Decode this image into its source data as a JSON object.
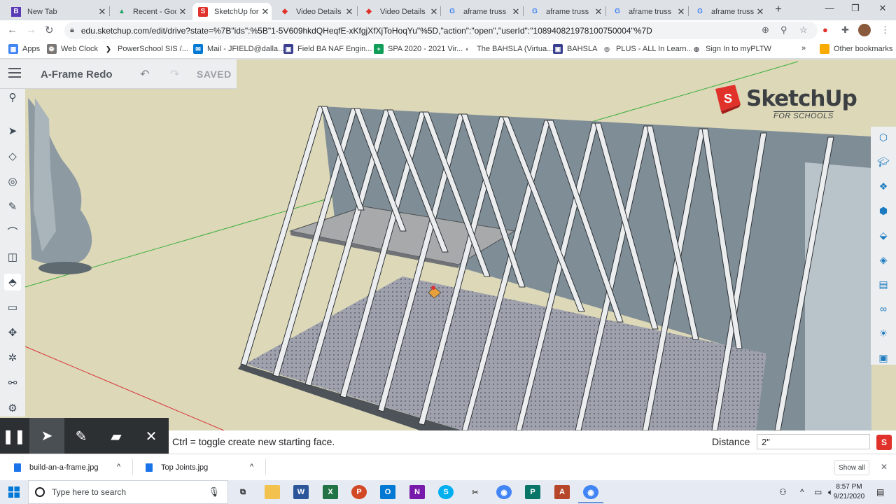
{
  "browser": {
    "tabs": [
      {
        "title": "New Tab",
        "favicon": "B",
        "color": "#5b3bb5"
      },
      {
        "title": "Recent - Goog",
        "favicon": "▲",
        "color": "#1fa463"
      },
      {
        "title": "SketchUp for S",
        "favicon": "S",
        "color": "#e0312b",
        "active": true
      },
      {
        "title": "Video Details",
        "favicon": "◆",
        "color": "#e0312b"
      },
      {
        "title": "Video Details",
        "favicon": "◆",
        "color": "#e0312b"
      },
      {
        "title": "aframe truss",
        "favicon": "G",
        "color": "#4285f4"
      },
      {
        "title": "aframe truss",
        "favicon": "G",
        "color": "#4285f4"
      },
      {
        "title": "aframe truss",
        "favicon": "G",
        "color": "#4285f4"
      },
      {
        "title": "aframe truss",
        "favicon": "G",
        "color": "#4285f4"
      }
    ],
    "url": "edu.sketchup.com/edit/drive?state=%7B\"ids\":%5B\"1-5V609hkdQHeqfE-xKfgjXfXjToHoqYu\"%5D,\"action\":\"open\",\"userId\":\"108940821978100750004\"%7D",
    "bookmarks": [
      {
        "label": "Apps",
        "color": "#4285f4",
        "icon": "▦"
      },
      {
        "label": "Web Clock",
        "color": "#777777",
        "icon": "⌚"
      },
      {
        "label": "PowerSchool SIS /...",
        "color": "#202124",
        "icon": "❯"
      },
      {
        "label": "Mail - JFIELD@dalla...",
        "color": "#0078d4",
        "icon": "✉"
      },
      {
        "label": "Field BA NAF Engin...",
        "color": "#3a3f8f",
        "icon": "▣"
      },
      {
        "label": "SPA 2020 - 2021 Vir...",
        "color": "#0f9d58",
        "icon": "+"
      },
      {
        "label": "The BAHSLA (Virtua...",
        "color": "#5f6368",
        "icon": "◐"
      },
      {
        "label": "BAHSLA",
        "color": "#3a3f8f",
        "icon": "▣"
      },
      {
        "label": "PLUS - ALL In Learn...",
        "color": "#5f6368",
        "icon": "◎"
      },
      {
        "label": "Sign In to myPLTW",
        "color": "#5f6368",
        "icon": "◍"
      }
    ],
    "more_bookmarks": "»",
    "other_bookmarks": "Other bookmarks"
  },
  "app": {
    "model_title": "A-Frame Redo",
    "save_status": "SAVED",
    "logo_title": "SketchUp",
    "logo_sub": "FOR SCHOOLS",
    "accent_color": "#e0312b"
  },
  "statusbar": {
    "hint": "Ctrl = toggle create new starting face.",
    "distance_label": "Distance",
    "distance_value": "2\""
  },
  "downloads": {
    "files": [
      {
        "name": "build-an-a-frame.jpg"
      },
      {
        "name": "Top Joints.jpg"
      }
    ],
    "show_all": "Show all"
  },
  "taskbar": {
    "search_placeholder": "Type here to search",
    "time": "8:57 PM",
    "date": "9/21/2020"
  }
}
